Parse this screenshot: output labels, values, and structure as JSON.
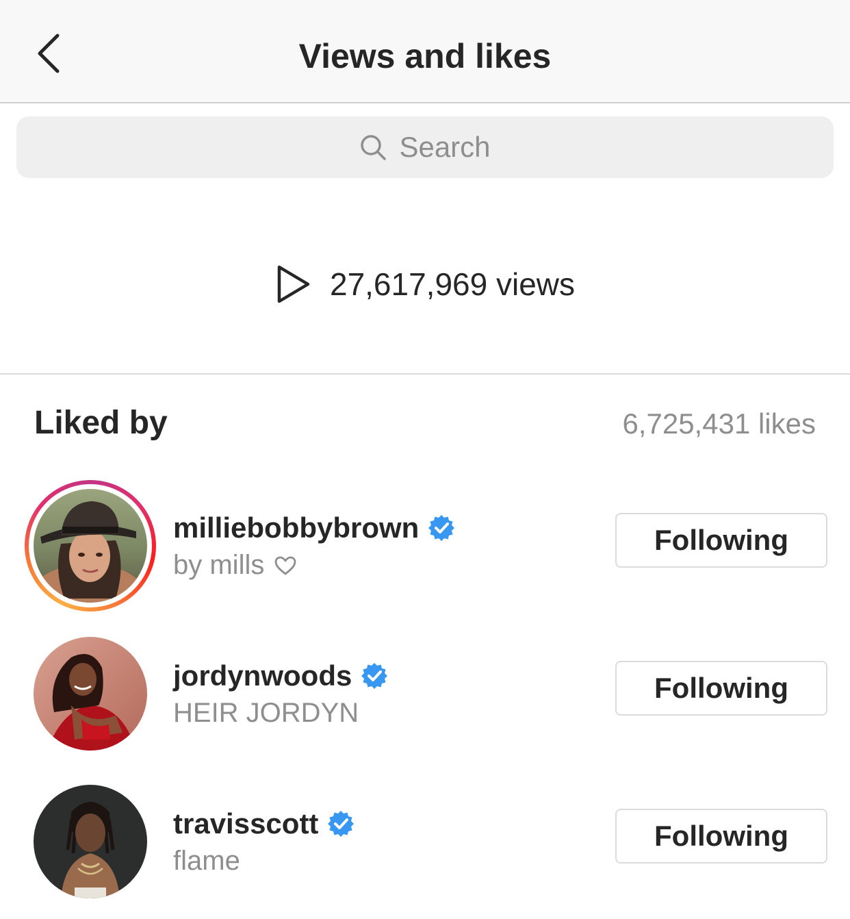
{
  "header": {
    "title": "Views and likes",
    "back_icon": "chevron-left-icon"
  },
  "search": {
    "placeholder": "Search",
    "icon": "search-icon"
  },
  "views": {
    "icon": "play-icon",
    "text": "27,617,969 views"
  },
  "liked_by": {
    "title": "Liked by",
    "count_text": "6,725,431 likes"
  },
  "users": [
    {
      "username": "milliebobbybrown",
      "verified": true,
      "fullname": "by mills",
      "has_heart": true,
      "has_story_ring": true,
      "button_label": "Following"
    },
    {
      "username": "jordynwoods",
      "verified": true,
      "fullname": "HEIR JORDYN",
      "has_heart": false,
      "has_story_ring": false,
      "button_label": "Following"
    },
    {
      "username": "travisscott",
      "verified": true,
      "fullname": "flame",
      "has_heart": false,
      "has_story_ring": false,
      "button_label": "Following"
    }
  ],
  "colors": {
    "verified_blue": "#3897f0",
    "text_primary": "#262626",
    "text_secondary": "#8e8e8e",
    "border": "#dbdbdb"
  }
}
